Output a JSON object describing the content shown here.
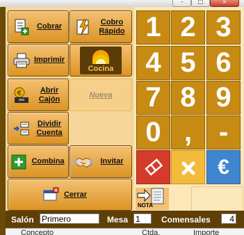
{
  "buttons": {
    "cobrar": "Cobrar",
    "cobro_rapido_line1": "Cobro",
    "cobro_rapido_line2": "Rápido",
    "imprimir": "Imprimir",
    "cocina": "Cocina",
    "abrir_cajon_line1": "Abrir",
    "abrir_cajon_line2": "Cajón",
    "nueva": "Nueva",
    "dividir_cuenta_line1": "Dividir",
    "dividir_cuenta_line2": "Cuenta",
    "combina": "Combina",
    "invitar": "Invitar",
    "cerrar": "Cerrar",
    "nota": "NOTA"
  },
  "keypad": {
    "keys": [
      "1",
      "2",
      "3",
      "4",
      "5",
      "6",
      "7",
      "8",
      "9",
      "0",
      ",",
      "-"
    ],
    "clear_icon": "eraser-icon",
    "cancel_icon": "x-icon",
    "euro_label": "€"
  },
  "info": {
    "salon_label": "Salón",
    "salon_value": "Primero",
    "mesa_label": "Mesa",
    "mesa_value": "1",
    "comensales_label": "Comensales",
    "comensales_value": "4"
  },
  "grid": {
    "columns": [
      "Concepto",
      "Ctda.",
      "Importe"
    ]
  },
  "window": {
    "minimize": "–",
    "maximize": "□",
    "close": "×"
  },
  "colors": {
    "accent": "#c78b14",
    "button_top": "#f3c173",
    "button_bottom": "#dc9424",
    "red_key": "#d43b2b",
    "yellow_key": "#f3bb3c",
    "blue_key": "#3f86cf"
  }
}
